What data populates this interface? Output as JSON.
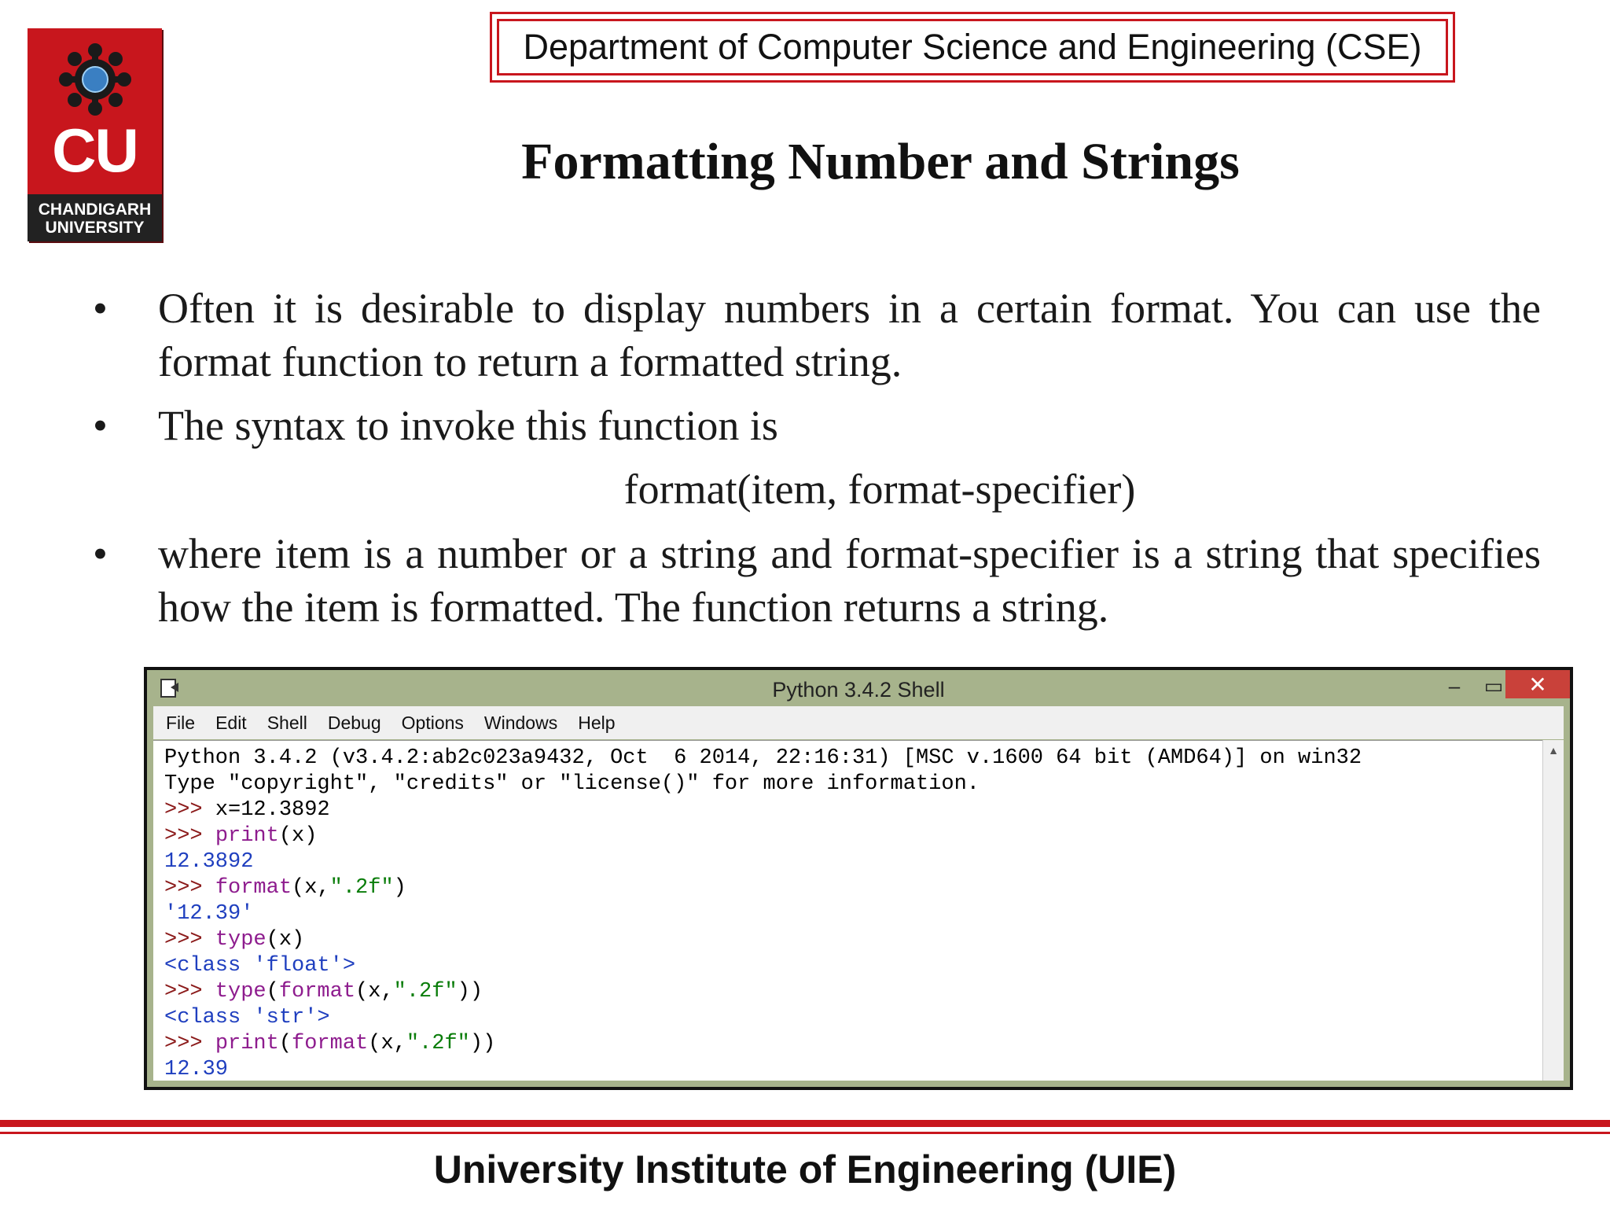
{
  "logo": {
    "abbr": "CU",
    "name_line1": "CHANDIGARH",
    "name_line2": "UNIVERSITY"
  },
  "header": {
    "department": "Department of Computer Science and Engineering (CSE)"
  },
  "slide": {
    "title": "Formatting Number and Strings",
    "bullet1": "Often it is desirable to display numbers in a certain format. You can use the format function to return a formatted string.",
    "bullet2": "The syntax to invoke this function is",
    "syntax": "format(item, format-specifier)",
    "bullet3": "where item is a number or a string and format-specifier is a string that specifies how the item is formatted. The function returns a string."
  },
  "shell": {
    "title": "Python 3.4.2 Shell",
    "menu": [
      "File",
      "Edit",
      "Shell",
      "Debug",
      "Options",
      "Windows",
      "Help"
    ],
    "banner1": "Python 3.4.2 (v3.4.2:ab2c023a9432, Oct  6 2014, 22:16:31) [MSC v.1600 64 bit (AMD64)] on win32",
    "banner2": "Type \"copyright\", \"credits\" or \"license()\" for more information.",
    "prompt": ">>> ",
    "l1_code": "x=12.3892",
    "l2_fn": "print",
    "l2_args": "(x)",
    "l3_out": "12.3892",
    "l4_fn": "format",
    "l4_args1": "(x,",
    "l4_str": "\".2f\"",
    "l4_args2": ")",
    "l5_out": "'12.39'",
    "l6_fn": "type",
    "l6_args": "(x)",
    "l7_out": "<class 'float'>",
    "l8_fn1": "type",
    "l8_p1": "(",
    "l8_fn2": "format",
    "l8_args1": "(x,",
    "l8_str": "\".2f\"",
    "l8_args2": "))",
    "l9_out": "<class 'str'>",
    "l10_fn1": "print",
    "l10_p1": "(",
    "l10_fn2": "format",
    "l10_args1": "(x,",
    "l10_str": "\".2f\"",
    "l10_args2": "))",
    "l11_out": "12.39"
  },
  "footer": {
    "text": "University Institute of Engineering (UIE)"
  },
  "colors": {
    "brand_red": "#c8161d",
    "shell_frame": "#a7b38c",
    "close_button": "#c9413a"
  }
}
